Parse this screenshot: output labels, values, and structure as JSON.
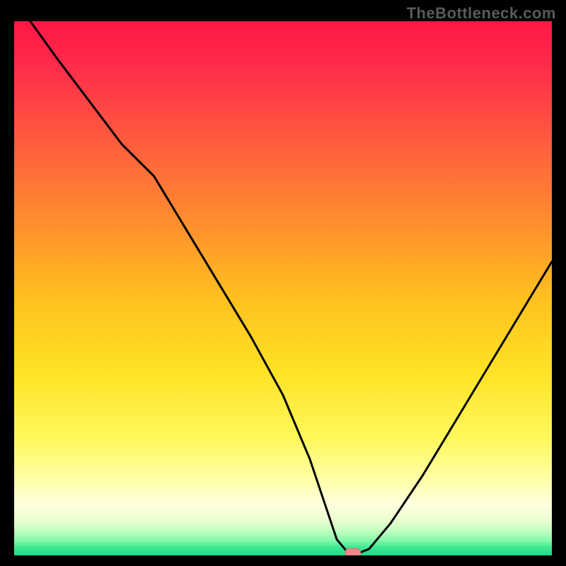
{
  "watermark": "TheBottleneck.com",
  "colors": {
    "frame": "#000000",
    "curve": "#000000",
    "marker_fill": "#f08a8a",
    "marker_stroke": "#cf6f6f",
    "gradient_stops": [
      {
        "offset": 0.0,
        "color": "#ff1744"
      },
      {
        "offset": 0.08,
        "color": "#ff2a4a"
      },
      {
        "offset": 0.22,
        "color": "#ff5a3f"
      },
      {
        "offset": 0.38,
        "color": "#ff8f2e"
      },
      {
        "offset": 0.52,
        "color": "#ffc11e"
      },
      {
        "offset": 0.66,
        "color": "#ffe326"
      },
      {
        "offset": 0.78,
        "color": "#fff85c"
      },
      {
        "offset": 0.86,
        "color": "#ffffa8"
      },
      {
        "offset": 0.905,
        "color": "#ffffe0"
      },
      {
        "offset": 0.935,
        "color": "#e9ffd0"
      },
      {
        "offset": 0.955,
        "color": "#bfffc0"
      },
      {
        "offset": 0.972,
        "color": "#85f9ab"
      },
      {
        "offset": 0.985,
        "color": "#3de993"
      },
      {
        "offset": 1.0,
        "color": "#18df86"
      }
    ]
  },
  "chart_data": {
    "type": "line",
    "title": "",
    "xlabel": "",
    "ylabel": "",
    "xlim": [
      0,
      100
    ],
    "ylim": [
      0,
      100
    ],
    "grid": false,
    "legend": false,
    "series": [
      {
        "name": "bottleneck-curve",
        "x": [
          3,
          8,
          14,
          20,
          26,
          32,
          38,
          44,
          50,
          55,
          58,
          60,
          62,
          64,
          66,
          70,
          76,
          82,
          88,
          94,
          100
        ],
        "y": [
          100,
          93,
          85,
          77,
          71,
          61,
          51,
          41,
          30,
          18,
          9,
          3,
          0.6,
          0.4,
          1.2,
          6,
          15,
          25,
          35,
          45,
          55
        ]
      }
    ],
    "marker": {
      "x": 63,
      "y": 0.5,
      "name": "optimal-point"
    }
  }
}
